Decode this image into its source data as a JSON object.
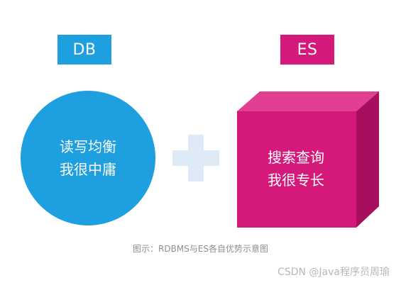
{
  "tags": {
    "db": "DB",
    "es": "ES"
  },
  "circle": {
    "line1": "读写均衡",
    "line2": "我很中庸"
  },
  "cube": {
    "line1": "搜索查询",
    "line2": "我很专长"
  },
  "caption": "图示：RDBMS与ES各自优势示意图",
  "watermark": "CSDN @Java程序员周瑜",
  "colors": {
    "db_blue": "#1e9fe0",
    "es_magenta": "#d4197a",
    "es_top": "#e23f92",
    "es_side": "#a80e5e",
    "plus": "#dfeaf7"
  },
  "icons": {
    "plus": "plus-icon"
  }
}
